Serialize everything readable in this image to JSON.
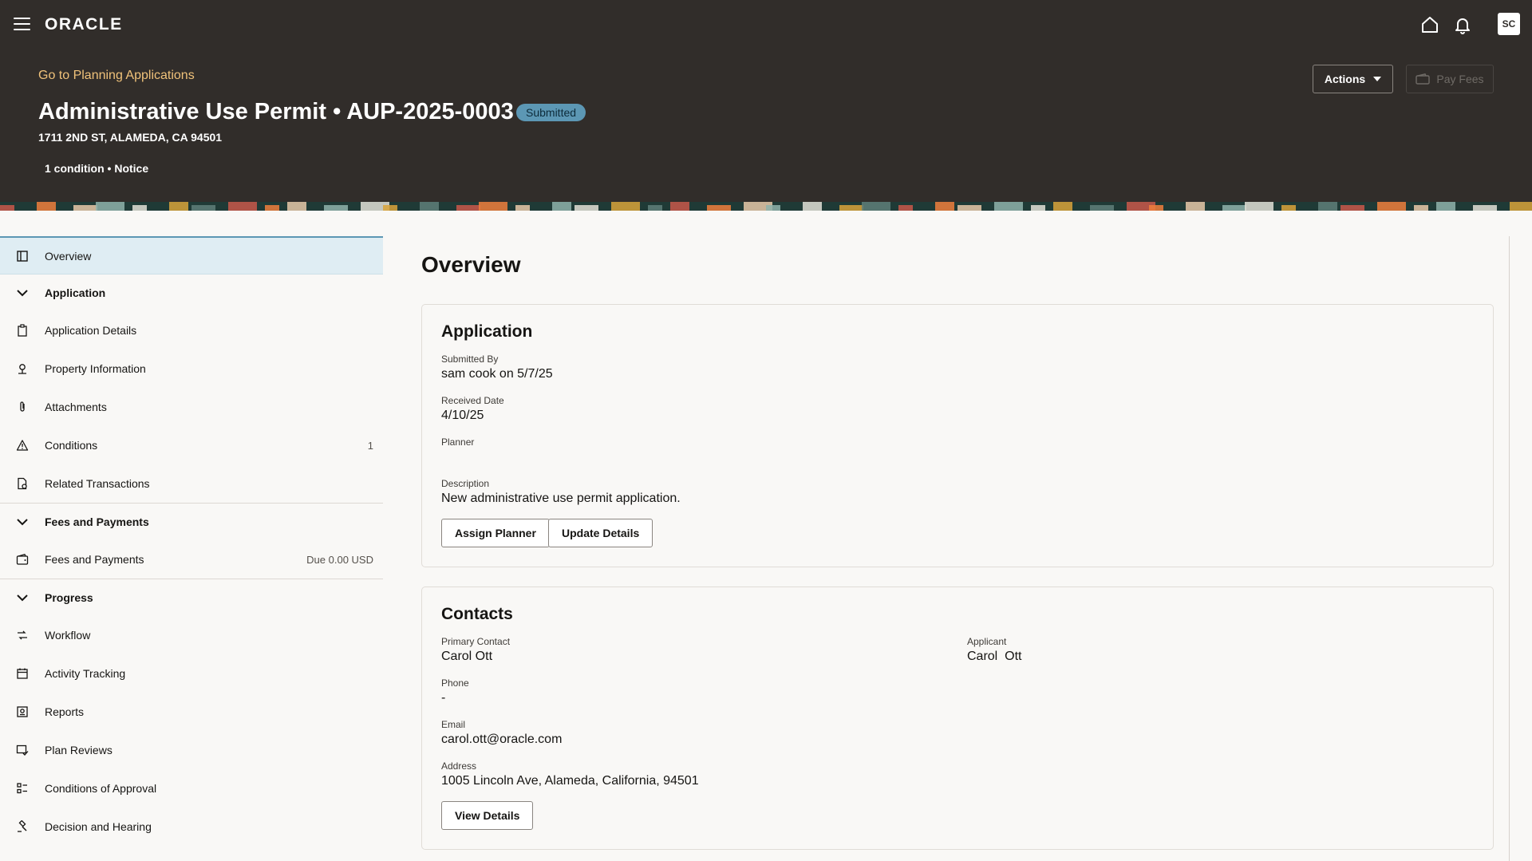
{
  "header": {
    "brand": "ORACLE",
    "avatar_initials": "SC",
    "back_link": "Go to Planning Applications",
    "title": "Administrative Use Permit • AUP-2025-0003",
    "status": "Submitted",
    "address": "1711 2ND ST, ALAMEDA, CA 94501",
    "conditions_summary": "1 condition • Notice",
    "actions_label": "Actions",
    "pay_fees_label": "Pay Fees"
  },
  "sidebar": {
    "overview": "Overview",
    "sections": {
      "application": "Application",
      "fees": "Fees and Payments",
      "progress": "Progress"
    },
    "application_items": [
      {
        "label": "Application Details",
        "icon": "clipboard-icon"
      },
      {
        "label": "Property Information",
        "icon": "property-icon"
      },
      {
        "label": "Attachments",
        "icon": "paperclip-icon"
      },
      {
        "label": "Conditions",
        "icon": "warning-icon",
        "count": "1"
      },
      {
        "label": "Related Transactions",
        "icon": "document-link-icon"
      }
    ],
    "fees_items": [
      {
        "label": "Fees and Payments",
        "icon": "wallet-icon",
        "meta": "Due 0.00 USD"
      }
    ],
    "progress_items": [
      {
        "label": "Workflow",
        "icon": "workflow-icon"
      },
      {
        "label": "Activity Tracking",
        "icon": "calendar-icon"
      },
      {
        "label": "Reports",
        "icon": "report-icon"
      },
      {
        "label": "Plan Reviews",
        "icon": "plan-review-icon"
      },
      {
        "label": "Conditions of Approval",
        "icon": "checklist-icon"
      },
      {
        "label": "Decision and Hearing",
        "icon": "gavel-icon"
      }
    ]
  },
  "main": {
    "title": "Overview",
    "application_card": {
      "title": "Application",
      "submitted_by_label": "Submitted By",
      "submitted_by_value": "sam cook on 5/7/25",
      "received_date_label": "Received Date",
      "received_date_value": "4/10/25",
      "planner_label": "Planner",
      "planner_value": "",
      "description_label": "Description",
      "description_value": "New administrative use permit application.",
      "assign_planner_label": "Assign Planner",
      "update_details_label": "Update Details"
    },
    "contacts_card": {
      "title": "Contacts",
      "primary_contact_label": "Primary Contact",
      "primary_contact_value": "Carol Ott",
      "applicant_label": "Applicant",
      "applicant_value": "Carol  Ott",
      "phone_label": "Phone",
      "phone_value": "-",
      "email_label": "Email",
      "email_value": "carol.ott@oracle.com",
      "address_label": "Address",
      "address_value": "1005 Lincoln Ave, Alameda, California, 94501",
      "view_details_label": "View Details"
    }
  },
  "colors": {
    "header_bg": "#312d2a",
    "link_gold": "#f0c27a",
    "status_badge": "#5c97b4",
    "selected_nav": "#dfedf3",
    "page_bg": "#f9f8f6"
  }
}
